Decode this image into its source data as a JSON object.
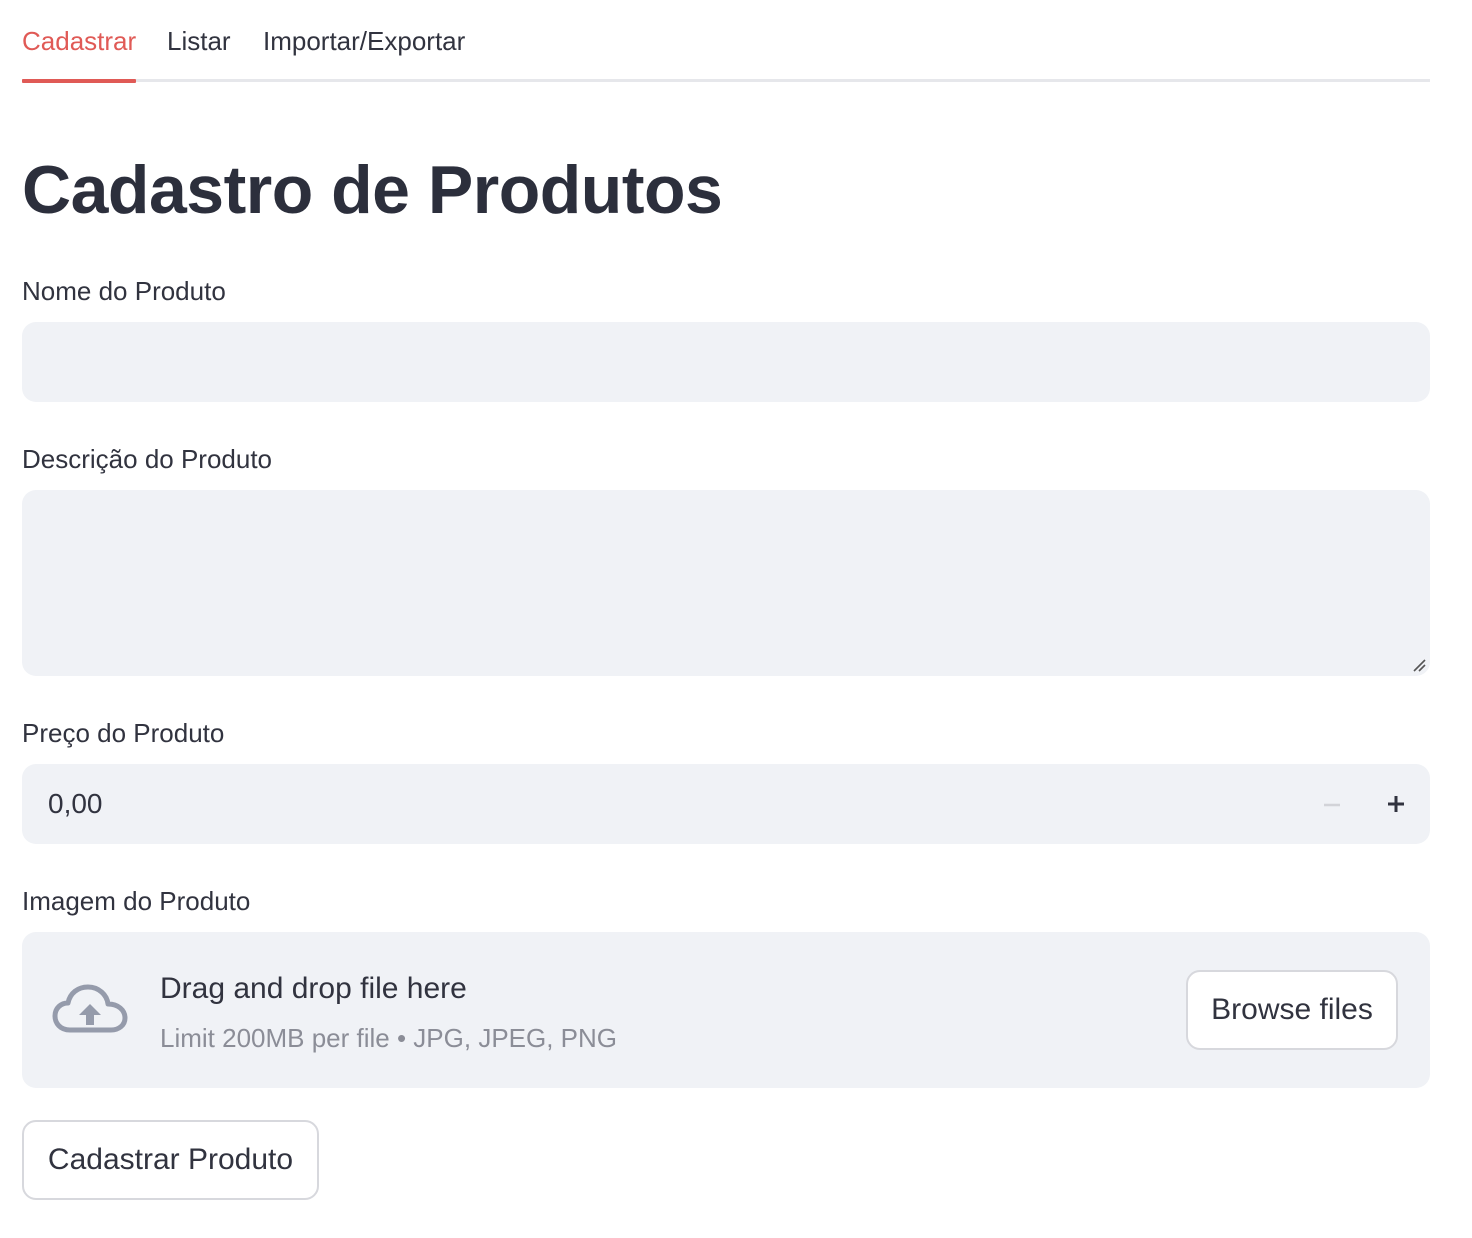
{
  "tabs": [
    {
      "label": "Cadastrar",
      "active": true
    },
    {
      "label": "Listar",
      "active": false
    },
    {
      "label": "Importar/Exportar",
      "active": false
    }
  ],
  "accent_color": "#e05a56",
  "page_title": "Cadastro de Produtos",
  "form": {
    "name": {
      "label": "Nome do Produto",
      "value": ""
    },
    "description": {
      "label": "Descrição do Produto",
      "value": ""
    },
    "price": {
      "label": "Preço do Produto",
      "value": "0,00",
      "decrement_icon": "minus-icon",
      "increment_icon": "plus-icon"
    },
    "image": {
      "label": "Imagem do Produto",
      "icon": "cloud-upload-icon",
      "drop_title": "Drag and drop file here",
      "drop_hint": "Limit 200MB per file • JPG, JPEG, PNG",
      "browse_label": "Browse files"
    },
    "submit_label": "Cadastrar Produto"
  }
}
